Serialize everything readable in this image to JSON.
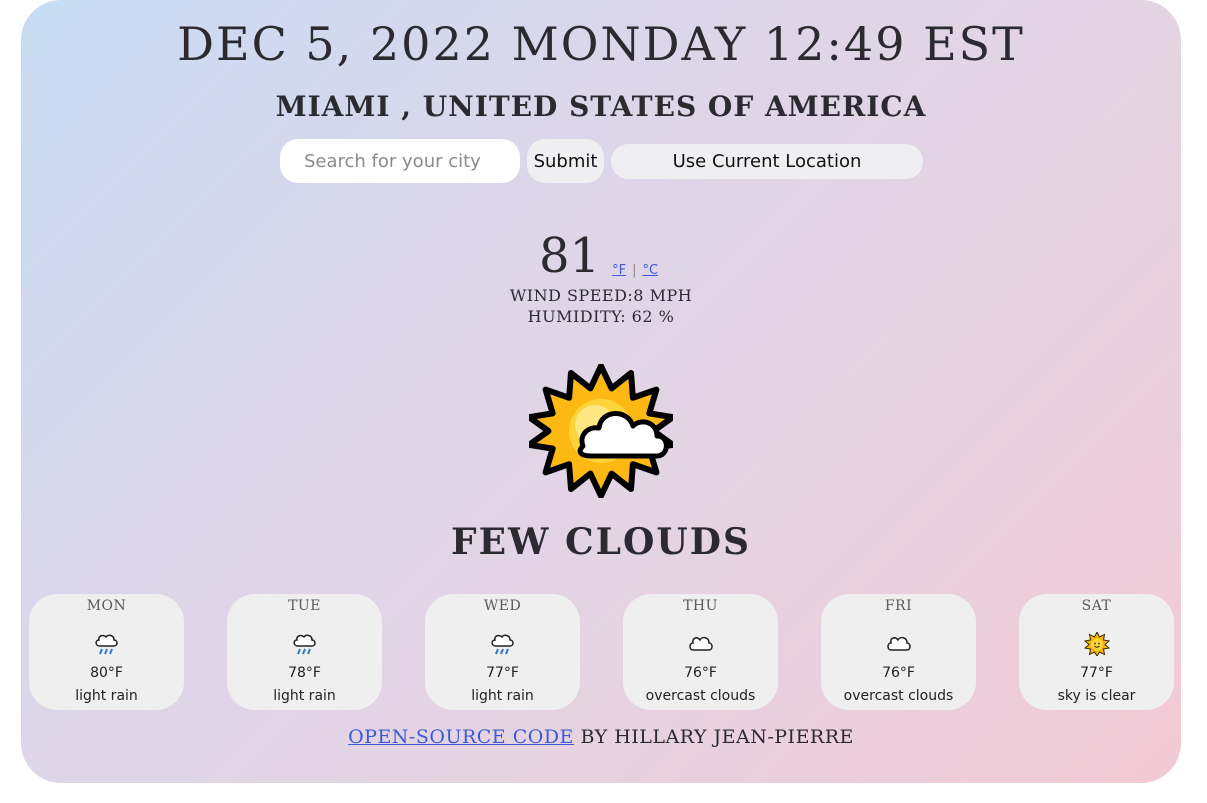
{
  "header": {
    "datetime": "DEC 5, 2022 MONDAY 12:49 EST",
    "location": "MIAMI , UNITED STATES OF AMERICA"
  },
  "search": {
    "placeholder": "Search for your city",
    "submit_label": "Submit",
    "current_location_label": "Use Current Location"
  },
  "current": {
    "temperature": "81",
    "unit_f": "°F",
    "unit_c": "°C",
    "separator": "|",
    "wind_speed": "WIND SPEED:8 MPH",
    "humidity": "HUMIDITY: 62 %",
    "icon": "sun-behind-cloud-icon",
    "description": "FEW CLOUDS"
  },
  "forecast": [
    {
      "day": "MON",
      "icon": "rain-cloud-icon",
      "temp": "80°F",
      "desc": "light rain"
    },
    {
      "day": "TUE",
      "icon": "rain-cloud-icon",
      "temp": "78°F",
      "desc": "light rain"
    },
    {
      "day": "WED",
      "icon": "rain-cloud-icon",
      "temp": "77°F",
      "desc": "light rain"
    },
    {
      "day": "THU",
      "icon": "cloud-icon",
      "temp": "76°F",
      "desc": "overcast clouds"
    },
    {
      "day": "FRI",
      "icon": "cloud-icon",
      "temp": "76°F",
      "desc": "overcast clouds"
    },
    {
      "day": "SAT",
      "icon": "sun-icon",
      "temp": "77°F",
      "desc": "sky is clear"
    }
  ],
  "footer": {
    "link_text": "OPEN-SOURCE CODE",
    "suffix": " BY HILLARY JEAN-PIERRE"
  },
  "colors": {
    "gradient_start": "#c7dcf3",
    "gradient_end": "#f3cad5",
    "link": "#3b5bd6",
    "sun_yellow": "#fdc500",
    "card_bg": "#efefef"
  }
}
